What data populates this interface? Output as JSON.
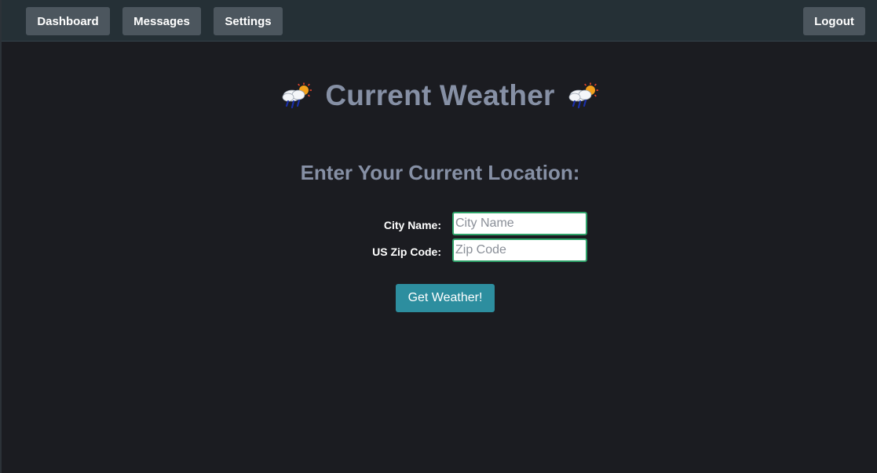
{
  "nav": {
    "dashboard": "Dashboard",
    "messages": "Messages",
    "settings": "Settings",
    "logout": "Logout"
  },
  "header": {
    "title": "Current Weather",
    "icon": "rain-sun-cloud-icon"
  },
  "form": {
    "heading": "Enter Your Current Location:",
    "city_label": "City Name:",
    "city_value": "",
    "city_placeholder": "City Name",
    "zip_label": "US Zip Code:",
    "zip_value": "",
    "zip_placeholder": "Zip Code",
    "submit_label": "Get Weather!"
  },
  "colors": {
    "background": "#1b1c21",
    "navbar": "#253036",
    "nav_button": "#4c565e",
    "title": "#8690a5",
    "input_border": "#2fa36a",
    "submit": "#2d8e9f"
  }
}
